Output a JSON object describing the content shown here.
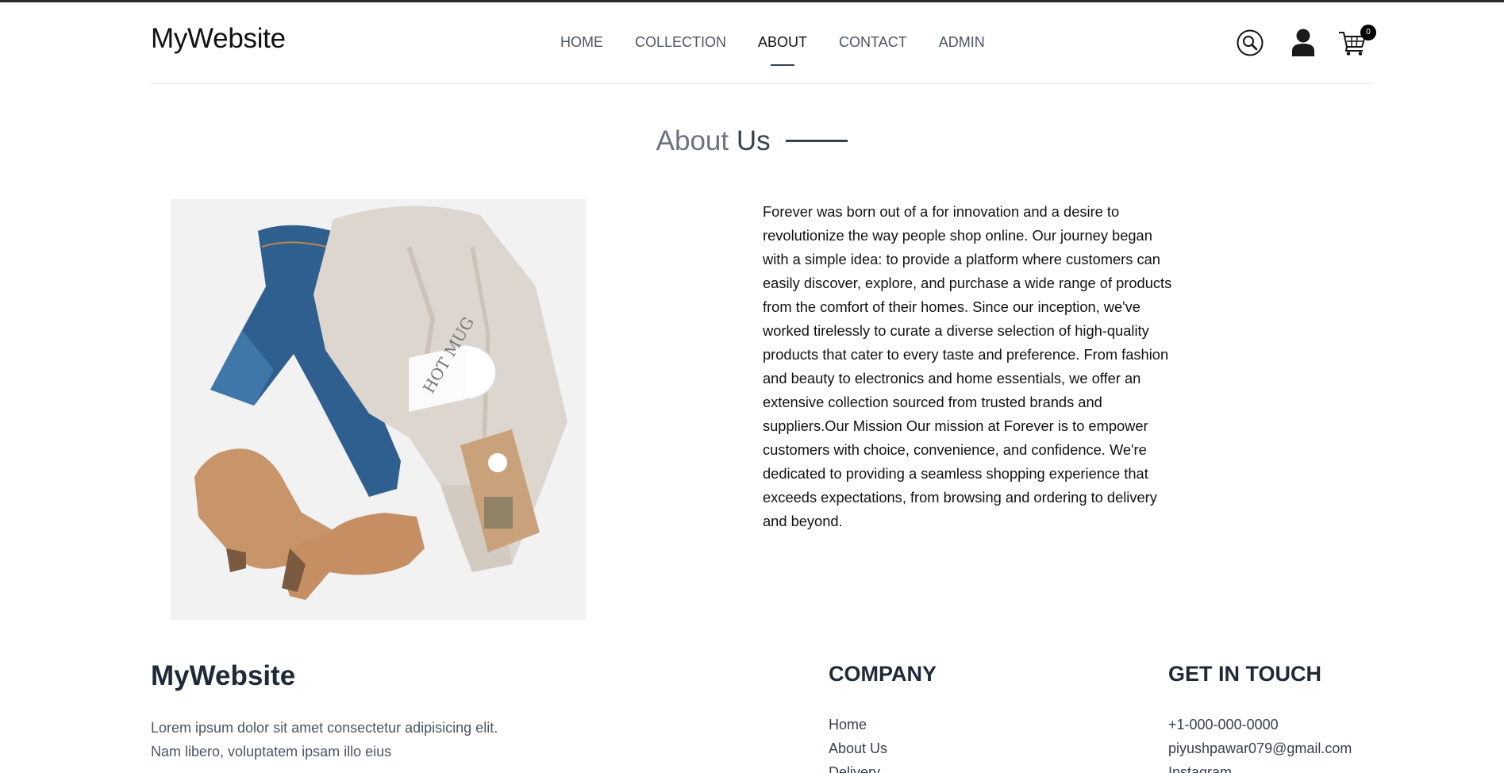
{
  "header": {
    "logo": "MyWebsite",
    "nav": [
      {
        "label": "HOME",
        "active": false
      },
      {
        "label": "COLLECTION",
        "active": false
      },
      {
        "label": "ABOUT",
        "active": true
      },
      {
        "label": "CONTACT",
        "active": false
      },
      {
        "label": "ADMIN",
        "active": false
      }
    ],
    "cart_count": "0"
  },
  "about": {
    "title_part1": "About",
    "title_part2": "Us",
    "body": "Forever was born out of a for innovation and a desire to revolutionize the way people shop online. Our journey began with a simple idea: to provide a platform where customers can easily discover, explore, and purchase a wide range of products from the comfort of their homes. Since our inception, we've worked tirelessly to curate a diverse selection of high-quality products that cater to every taste and preference. From fashion and beauty to electronics and home essentials, we offer an extensive collection sourced from trusted brands and suppliers.Our Mission Our mission at Forever is to empower customers with choice, convenience, and confidence. We're dedicated to providing a seamless shopping experience that exceeds expectations, from browsing and ordering to delivery and beyond."
  },
  "footer": {
    "brand": "MyWebsite",
    "description": "Lorem ipsum dolor sit amet consectetur adipisicing elit. Nam libero, voluptatem ipsam illo eius",
    "company": {
      "title": "COMPANY",
      "links": [
        "Home",
        "About Us",
        "Delivery"
      ]
    },
    "contact": {
      "title": "GET IN TOUCH",
      "items": [
        "+1-000-000-0000",
        "piyushpawar079@gmail.com",
        "Instagram"
      ]
    }
  },
  "colors": {
    "accent": "#374151",
    "text_muted": "#6b7280",
    "top_border": "#2b2b2b"
  },
  "icons": [
    "search-icon",
    "user-icon",
    "cart-icon"
  ]
}
